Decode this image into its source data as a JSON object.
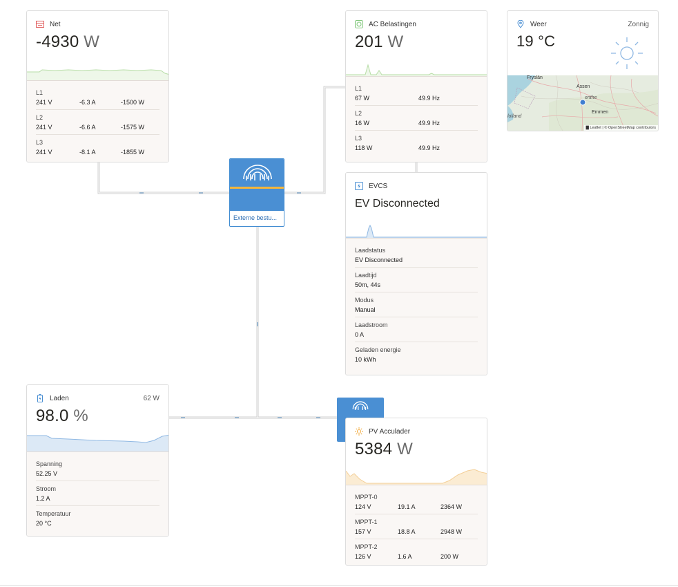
{
  "grid": {
    "title": "Net",
    "value": "-4930",
    "unit": "W",
    "phases": [
      {
        "label": "L1",
        "voltage": "241 V",
        "current": "-6.3 A",
        "power": "-1500 W"
      },
      {
        "label": "L2",
        "voltage": "241 V",
        "current": "-6.6 A",
        "power": "-1575 W"
      },
      {
        "label": "L3",
        "voltage": "241 V",
        "current": "-8.1 A",
        "power": "-1855 W"
      }
    ]
  },
  "ac_loads": {
    "title": "AC Belastingen",
    "value": "201",
    "unit": "W",
    "phases": [
      {
        "label": "L1",
        "power": "67 W",
        "freq": "49.9 Hz"
      },
      {
        "label": "L2",
        "power": "16 W",
        "freq": "49.9 Hz"
      },
      {
        "label": "L3",
        "power": "118 W",
        "freq": "49.9 Hz"
      }
    ]
  },
  "weather": {
    "title": "Weer",
    "condition": "Zonnig",
    "temperature": "19 °C",
    "map_labels": {
      "fryslan": "Fryslân",
      "assen": "Assen",
      "drenthe": "enthe",
      "emmen": "Emmen",
      "holland": "lolland"
    },
    "attribution": "▇ Leaflet | © OpenStreetMap contributors"
  },
  "inverter": {
    "label": "Externe bestu..."
  },
  "evcs": {
    "title": "EVCS",
    "status_big": "EV Disconnected",
    "rows": [
      {
        "label": "Laadstatus",
        "value": "EV Disconnected"
      },
      {
        "label": "Laadtijd",
        "value": "50m, 44s"
      },
      {
        "label": "Modus",
        "value": "Manual"
      },
      {
        "label": "Laadstroom",
        "value": "0 A"
      },
      {
        "label": "Geladen energie",
        "value": "10 kWh"
      }
    ]
  },
  "battery": {
    "title": "Laden",
    "power": "62 W",
    "value": "98.0",
    "unit": "%",
    "rows": [
      {
        "label": "Spanning",
        "value": "52.25 V"
      },
      {
        "label": "Stroom",
        "value": "1.2 A"
      },
      {
        "label": "Temperatuur",
        "value": "20 °C"
      }
    ]
  },
  "pv": {
    "title": "PV Acculader",
    "value": "5384",
    "unit": "W",
    "trackers": [
      {
        "label": "MPPT-0",
        "voltage": "124 V",
        "current": "19.1 A",
        "power": "2364 W"
      },
      {
        "label": "MPPT-1",
        "voltage": "157 V",
        "current": "18.8 A",
        "power": "2948 W"
      },
      {
        "label": "MPPT-2",
        "voltage": "126 V",
        "current": "1.6 A",
        "power": "200 W"
      }
    ]
  },
  "colors": {
    "grid_accent": "#e05a5a",
    "acload_accent": "#7cc576",
    "evcs_accent": "#4a8fd3",
    "battery_accent": "#8fb8e3",
    "pv_accent": "#f2a93b",
    "inverter_blue": "#4a8fd3",
    "wire": "#c9c9c9"
  },
  "icons": {
    "grid": "grid-icon",
    "acload": "ac-outlet-icon",
    "weather": "location-pin-icon",
    "sun": "sun-icon",
    "evcs": "ev-charger-icon",
    "battery": "battery-icon",
    "pv": "solar-icon",
    "inverter": "victron-logo-icon"
  }
}
